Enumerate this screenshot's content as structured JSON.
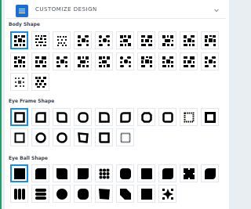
{
  "header": {
    "title": "CUSTOMIZE DESIGN"
  },
  "sections": {
    "body": {
      "label": "Body Shape",
      "row1_count": 10,
      "row2_count": 10,
      "row3_count": 2
    },
    "eye_frame": {
      "label": "Eye Frame Shape",
      "row1_count": 10,
      "row2_count": 6
    },
    "eye_ball": {
      "label": "Eye Ball Shape",
      "row1_count": 10,
      "row2_count": 10
    }
  },
  "colors": {
    "accent": "#1a6ed8",
    "selected_border": "#1a8de6",
    "green_bar": "#22a06b"
  }
}
